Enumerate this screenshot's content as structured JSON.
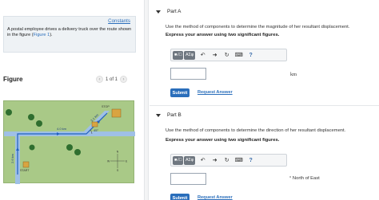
{
  "problem": {
    "constants_link": "Constants",
    "text": "A postal employee drives a delivery truck over the route shown in the figure (Figure 1).",
    "text_before_link": "A postal employee drives a delivery truck over the route shown in the figure (",
    "text_link": "Figure 1",
    "text_after_link": ")."
  },
  "figure": {
    "label": "Figure",
    "pager_text": "1 of 1",
    "prev_icon": "chevron-left-icon",
    "next_icon": "chevron-right-icon",
    "diagram": {
      "stop_label": "STOP",
      "start_label": "START",
      "seg1_label": "2.6 km",
      "seg2_label": "4.0 km",
      "seg3_label": "3.1 km",
      "angle_label": "45°",
      "compass": {
        "n": "N",
        "s": "S",
        "e": "E",
        "w": "W"
      },
      "colors": {
        "grass": "#a9c987",
        "road": "#8fb4e0",
        "route": "#1f5fbf",
        "house": "#d9a441",
        "tree": "#2f6e2f"
      }
    }
  },
  "part_a": {
    "title": "Part A",
    "question": "Use the method of components to determine the magnitude of her resultant displacement.",
    "instruction": "Express your answer using two significant figures.",
    "input_value": "",
    "unit": "km",
    "submit_label": "Submit",
    "request_label": "Request Answer"
  },
  "part_b": {
    "title": "Part B",
    "question": "Use the method of components to determine the direction of her resultant displacement.",
    "instruction": "Express your answer using two significant figures.",
    "input_value": "",
    "unit": "° North of East",
    "submit_label": "Submit",
    "request_label": "Request Answer"
  },
  "toolbar": {
    "template_label": "■√□",
    "greek_label": "ΑΣφ",
    "undo_icon": "undo-icon",
    "redo_icon": "redo-icon",
    "reset_icon": "reset-icon",
    "keyboard_icon": "keyboard-icon",
    "help_label": "?"
  },
  "colors": {
    "accent": "#2a6ebb",
    "toolbar_btn": "#6f7780",
    "panel_bg": "#eef2f5"
  }
}
